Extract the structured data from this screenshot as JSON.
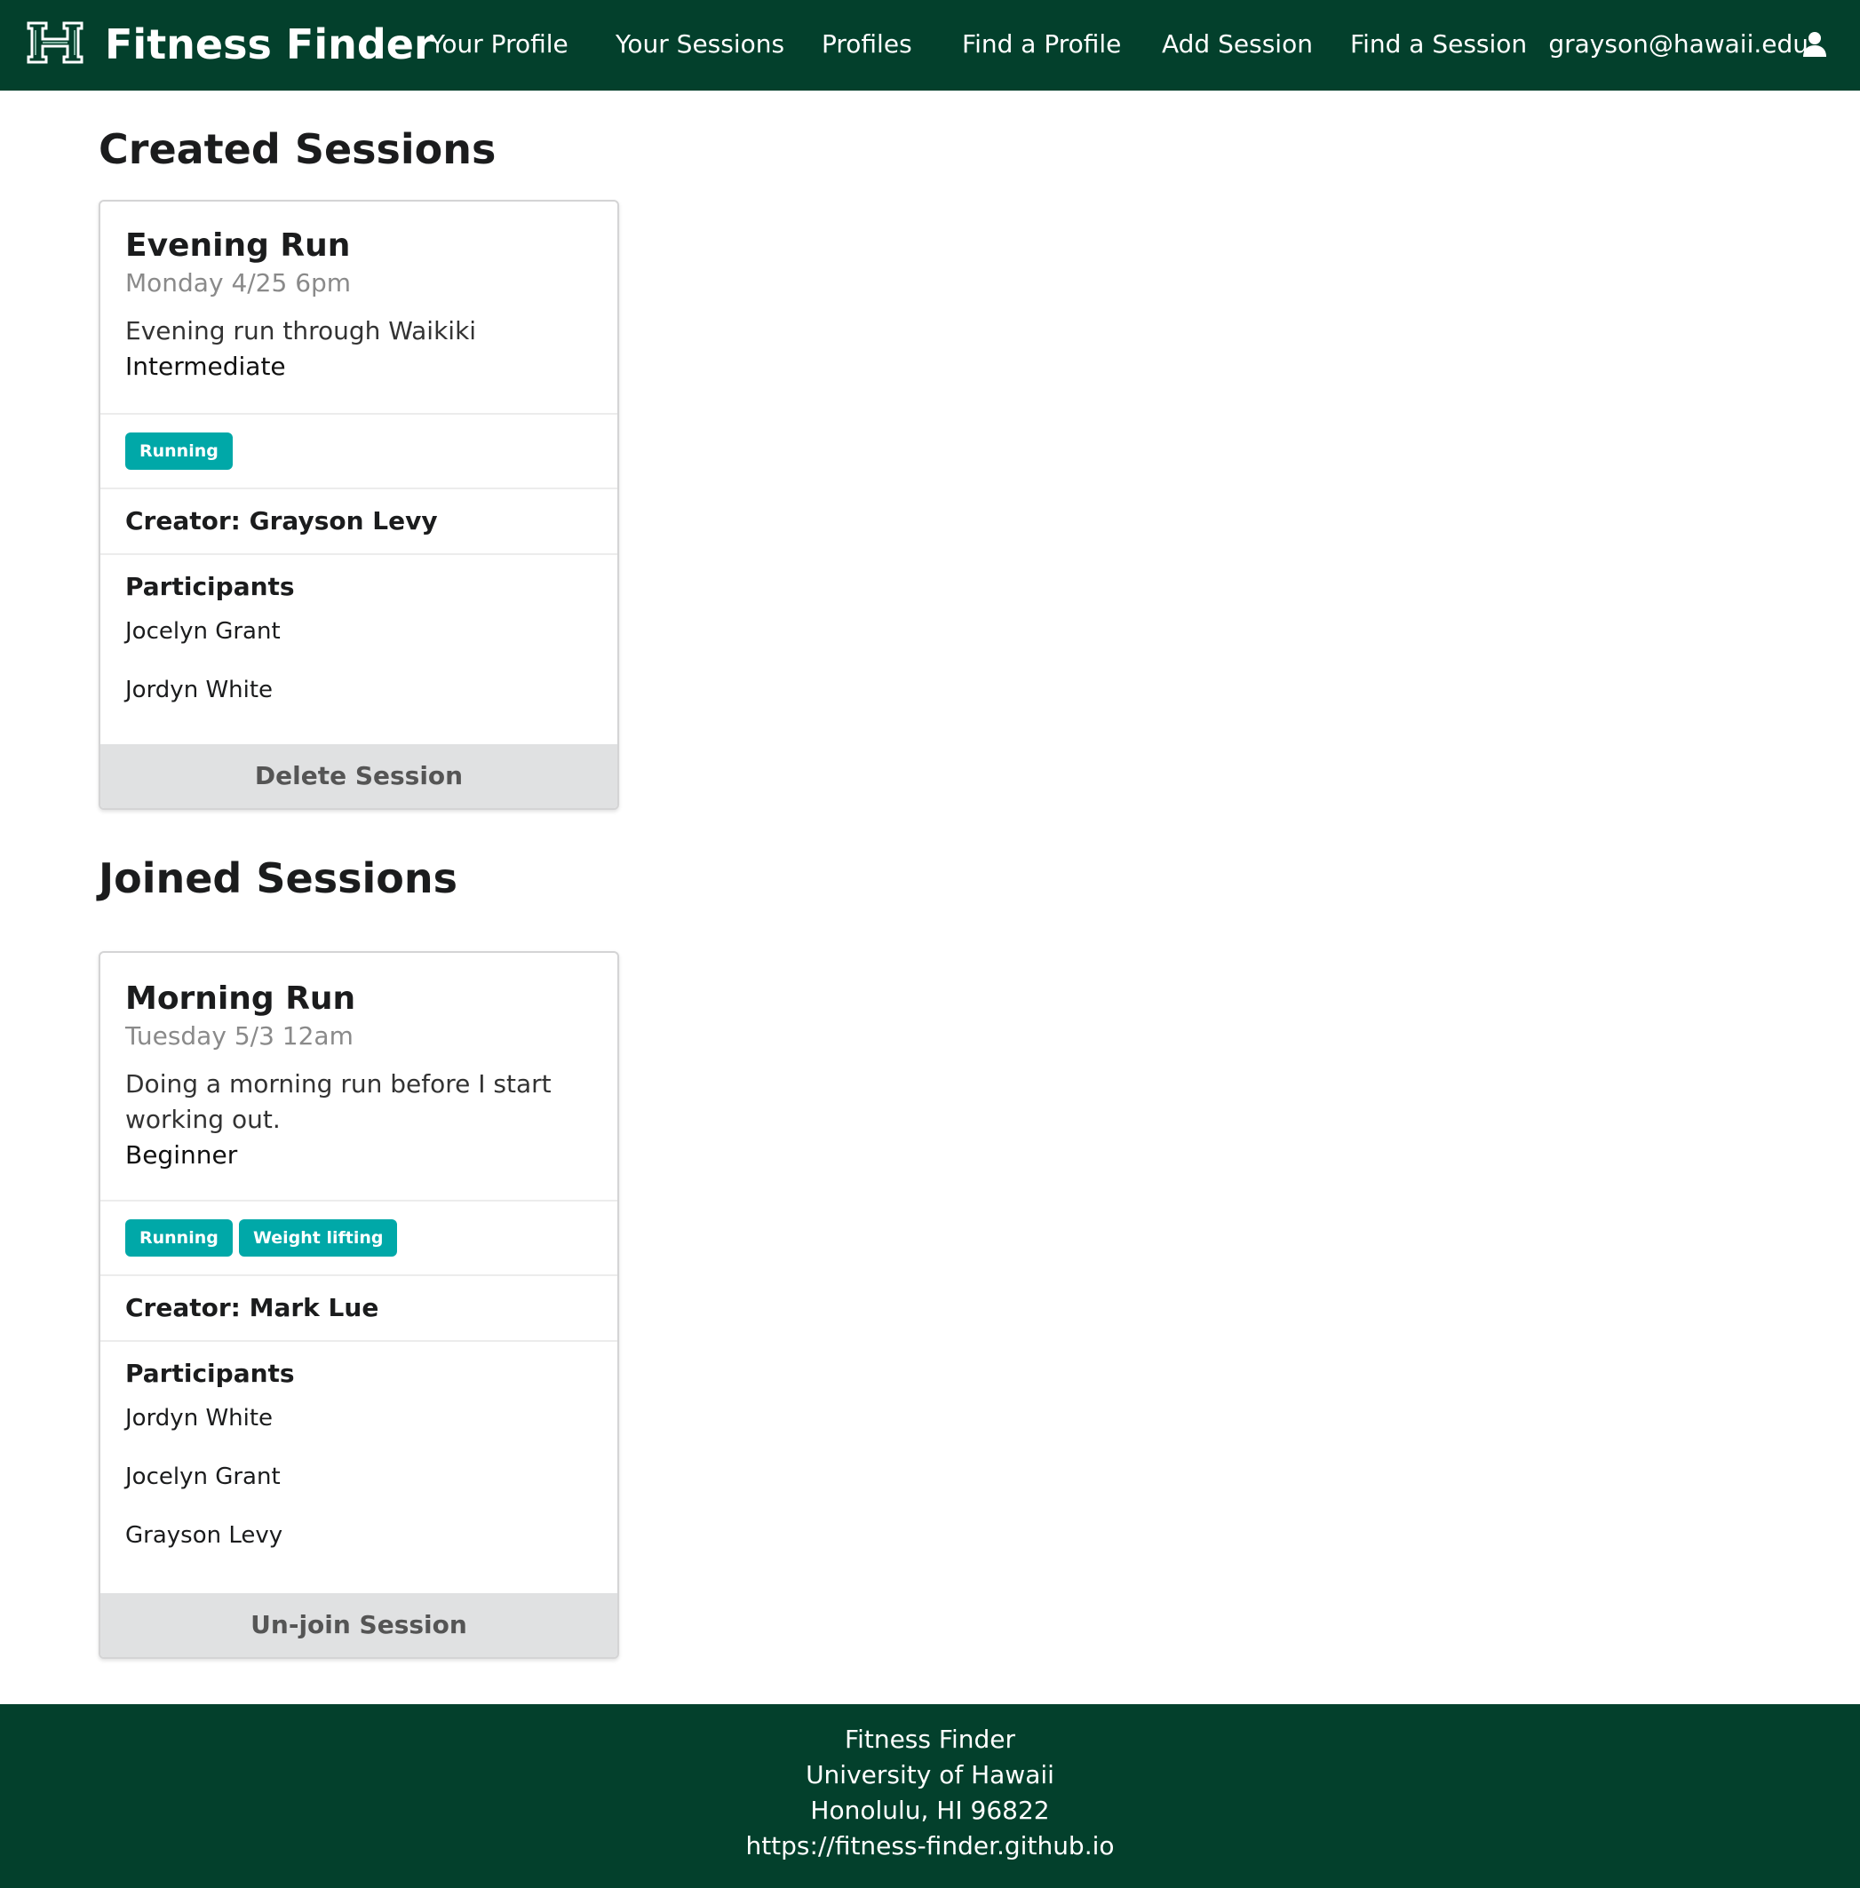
{
  "navbar": {
    "brand": "Fitness Finder",
    "logo_icon": "hawaii-h-logo-icon",
    "items": [
      {
        "label": "Your Profile"
      },
      {
        "label": "Your Sessions"
      },
      {
        "label": "Profiles"
      },
      {
        "label": "Find a Profile"
      },
      {
        "label": "Add Session"
      },
      {
        "label": "Find a Session"
      }
    ],
    "user_email": "grayson@hawaii.edu",
    "user_icon": "user-icon"
  },
  "created": {
    "heading": "Created Sessions",
    "session": {
      "title": "Evening Run",
      "datetime": "Monday 4/25 6pm",
      "description": "Evening run through Waikiki",
      "level": "Intermediate",
      "tags": [
        "Running"
      ],
      "creator": "Creator: Grayson Levy",
      "participants_heading": "Participants",
      "participants": [
        "Jocelyn Grant",
        "Jordyn White"
      ],
      "button_label": "Delete Session"
    }
  },
  "joined": {
    "heading": "Joined Sessions",
    "session": {
      "title": "Morning Run",
      "datetime": "Tuesday 5/3 12am",
      "description": "Doing a morning run before I start working out.",
      "level": "Beginner",
      "tags": [
        "Running",
        "Weight lifting"
      ],
      "creator": "Creator: Mark Lue",
      "participants_heading": "Participants",
      "participants": [
        "Jordyn White",
        "Jocelyn Grant",
        "Grayson Levy"
      ],
      "button_label": "Un-join Session"
    }
  },
  "footer": {
    "lines": [
      "Fitness Finder",
      "University of Hawaii",
      "Honolulu, HI 96822",
      "https://fitness-finder.github.io"
    ]
  },
  "colors": {
    "navbar_bg": "#03402c",
    "tag_bg": "#00a8a8",
    "button_bg": "#e0e1e2"
  }
}
